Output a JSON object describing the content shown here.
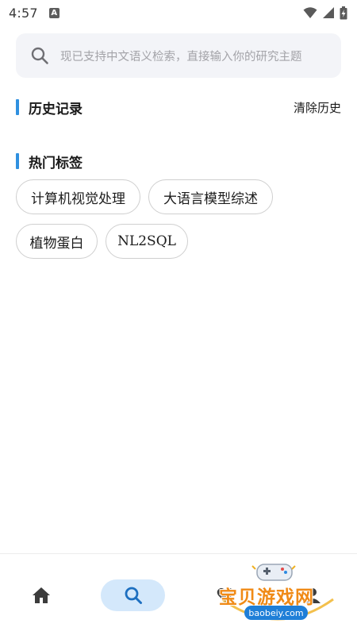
{
  "status_bar": {
    "time": "4:57",
    "app_indicator": "A",
    "icons": [
      "wifi-icon",
      "cellular-icon",
      "battery-icon"
    ]
  },
  "search": {
    "placeholder": "现已支持中文语义检索，直接输入你的研究主题",
    "icon": "search-icon"
  },
  "history": {
    "title": "历史记录",
    "clear_label": "清除历史",
    "items": []
  },
  "hot_tags": {
    "title": "热门标签",
    "tags": [
      "计算机视觉处理",
      "大语言模型综述",
      "植物蛋白",
      "NL2SQL"
    ]
  },
  "bottom_nav": {
    "items": [
      {
        "icon": "home-icon",
        "active": false
      },
      {
        "icon": "search-icon",
        "active": true
      },
      {
        "icon": "favorite-icon",
        "active": false
      },
      {
        "icon": "profile-icon",
        "active": false
      }
    ]
  },
  "watermark": {
    "title": "宝贝游戏网",
    "url": "baobeiy.com"
  },
  "colors": {
    "accent": "#2f90e0",
    "nav_active_bg": "#d4e8fb",
    "search_bg": "#f3f4f8",
    "placeholder": "#a3a3a8",
    "tag_border": "#cfcfcf"
  }
}
